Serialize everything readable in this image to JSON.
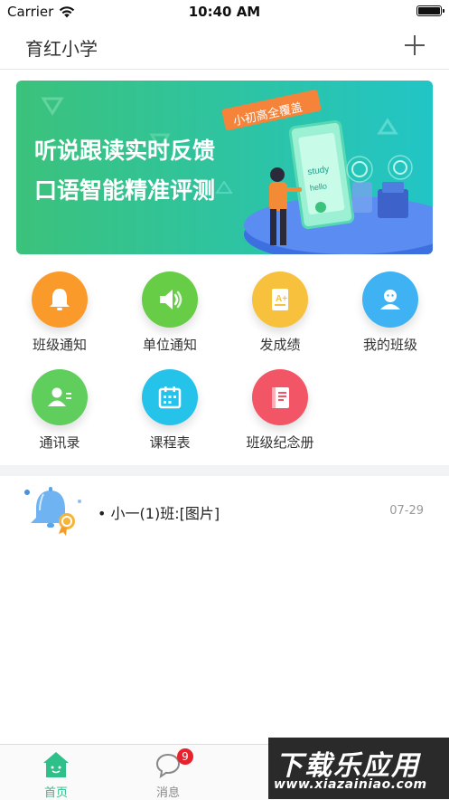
{
  "status_bar": {
    "carrier": "Carrier",
    "time": "10:40 AM",
    "battery_level": 1.0
  },
  "header": {
    "title": "育红小学",
    "add_icon": "plus-icon"
  },
  "banner": {
    "tag": "小初高全覆盖",
    "headline_1": "听说跟读实时反馈",
    "headline_2": "口语智能精准评测",
    "screen_words": [
      "study",
      "hello"
    ],
    "colors": {
      "start": "#39c07f",
      "end": "#1ec6c9"
    }
  },
  "features": [
    {
      "label": "班级通知",
      "icon": "bell-icon",
      "color": "#fa9a2b"
    },
    {
      "label": "单位通知",
      "icon": "speaker-icon",
      "color": "#67cd46"
    },
    {
      "label": "发成绩",
      "icon": "grade-icon",
      "color": "#f7c13e"
    },
    {
      "label": "我的班级",
      "icon": "class-icon",
      "color": "#3eb2f3"
    },
    {
      "label": "通讯录",
      "icon": "contacts-icon",
      "color": "#5fce5c"
    },
    {
      "label": "课程表",
      "icon": "calendar-icon",
      "color": "#25c3ea"
    },
    {
      "label": "班级纪念册",
      "icon": "album-icon",
      "color": "#f25565"
    }
  ],
  "messages": [
    {
      "text": "• 小一(1)班:[图片]",
      "date": "07-29",
      "icon": "notification-bell-icon"
    }
  ],
  "tabbar": {
    "tabs": [
      {
        "label": "首页",
        "icon": "home-icon",
        "active": true
      },
      {
        "label": "消息",
        "icon": "chat-icon",
        "badge": "9",
        "active": false
      }
    ],
    "active_color": "#2fc08a",
    "inactive_color": "#888888"
  },
  "watermark": {
    "title": "下载乐应用",
    "url": "www.xiazainiao.com"
  }
}
